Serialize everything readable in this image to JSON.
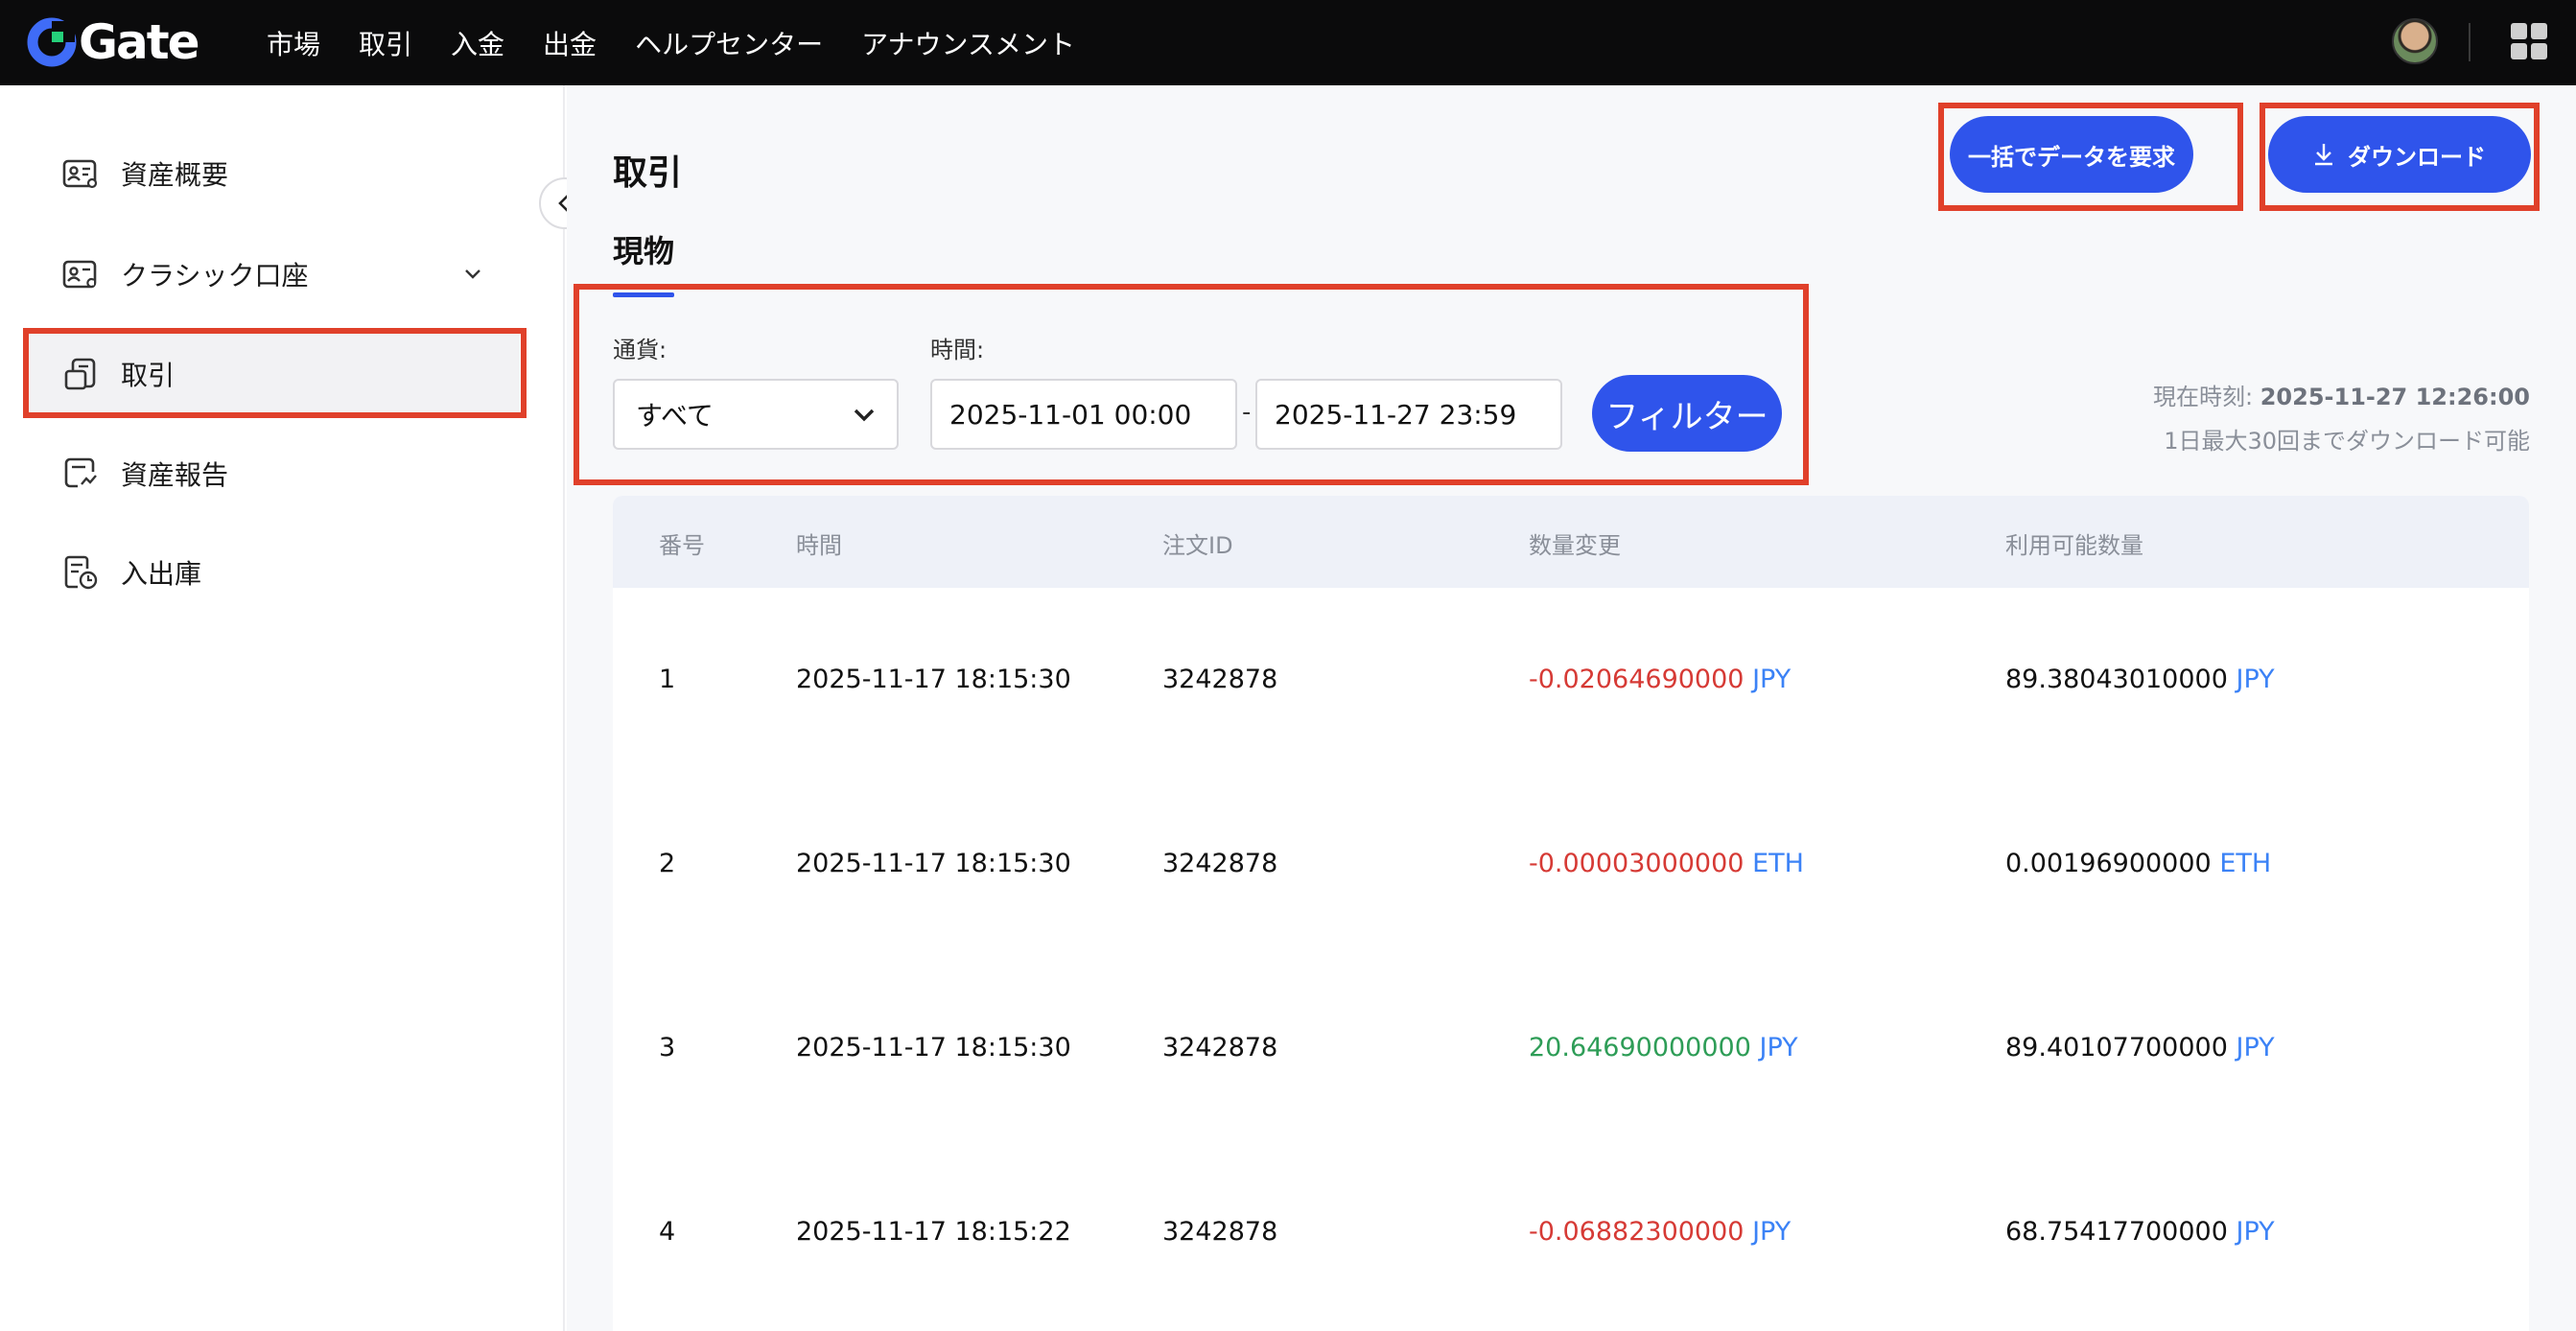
{
  "brand": {
    "name": "Gate"
  },
  "nav": {
    "items": [
      "市場",
      "取引",
      "入金",
      "出金",
      "ヘルプセンター",
      "アナウンスメント"
    ]
  },
  "sidebar": {
    "items": [
      {
        "label": "資産概要",
        "icon": "asset-overview-icon"
      },
      {
        "label": "クラシック口座",
        "icon": "classic-account-icon"
      },
      {
        "label": "取引",
        "icon": "trade-icon"
      },
      {
        "label": "資産報告",
        "icon": "asset-report-icon"
      },
      {
        "label": "入出庫",
        "icon": "deposit-withdraw-icon"
      }
    ],
    "active_index": 2
  },
  "header": {
    "title": "取引",
    "bulk_request_label": "一括でデータを要求",
    "download_label": "ダウンロード"
  },
  "tabs": {
    "spot_label": "現物"
  },
  "filters": {
    "currency_label": "通貨:",
    "currency_value": "すべて",
    "time_label": "時間:",
    "start_value": "2025-11-01 00:00",
    "separator": "-",
    "end_value": "2025-11-27 23:59",
    "filter_button": "フィルター"
  },
  "info": {
    "current_time_label": "現在時刻:",
    "current_time_value": "2025-11-27 12:26:00",
    "limit_note": "1日最大30回までダウンロード可能"
  },
  "table": {
    "columns": [
      "番号",
      "時間",
      "注文ID",
      "数量変更",
      "利用可能数量"
    ],
    "rows": [
      {
        "no": "1",
        "time": "2025-11-17 18:15:30",
        "order_id": "3242878",
        "change": "-0.02064690000",
        "change_ccy": "JPY",
        "change_sign": "neg",
        "available": "89.38043010000",
        "available_ccy": "JPY"
      },
      {
        "no": "2",
        "time": "2025-11-17 18:15:30",
        "order_id": "3242878",
        "change": "-0.00003000000",
        "change_ccy": "ETH",
        "change_sign": "neg",
        "available": "0.00196900000",
        "available_ccy": "ETH"
      },
      {
        "no": "3",
        "time": "2025-11-17 18:15:30",
        "order_id": "3242878",
        "change": "20.64690000000",
        "change_ccy": "JPY",
        "change_sign": "pos",
        "available": "89.40107700000",
        "available_ccy": "JPY"
      },
      {
        "no": "4",
        "time": "2025-11-17 18:15:22",
        "order_id": "3242878",
        "change": "-0.06882300000",
        "change_ccy": "JPY",
        "change_sign": "neg",
        "available": "68.75417700000",
        "available_ccy": "JPY"
      }
    ]
  },
  "colors": {
    "accent": "#2f54eb",
    "negative": "#d63a35",
    "positive": "#2e9d57",
    "currency": "#3b82f6",
    "highlight": "#e0402a"
  }
}
